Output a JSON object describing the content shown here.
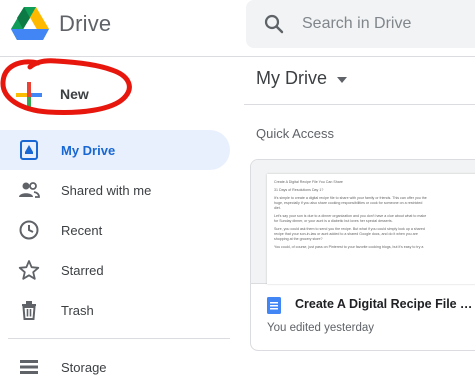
{
  "app": {
    "name": "Drive"
  },
  "search": {
    "placeholder": "Search in Drive",
    "value": "",
    "icon": "search-icon"
  },
  "new_button": {
    "label": "New"
  },
  "sidebar": {
    "items": [
      {
        "label": "My Drive",
        "icon": "my-drive-icon",
        "active": true
      },
      {
        "label": "Shared with me",
        "icon": "people-icon",
        "active": false
      },
      {
        "label": "Recent",
        "icon": "clock-icon",
        "active": false
      },
      {
        "label": "Starred",
        "icon": "star-icon",
        "active": false
      },
      {
        "label": "Trash",
        "icon": "trash-icon",
        "active": false
      }
    ],
    "storage": {
      "label": "Storage",
      "icon": "storage-icon"
    }
  },
  "main": {
    "title": "My Drive",
    "section": "Quick Access",
    "card": {
      "title": "Create A Digital Recipe File Y...",
      "subtitle": "You edited yesterday",
      "preview_lines": [
        "Create A Digital Recipe File You Can Share",
        "",
        "31 Days of Resolutions Day 1?",
        "",
        "It's simple to create a digital recipe file to share with your family or friends. This can offer you the",
        "huge, especially if you also share cooking responsibilities or cook for someone on a restricted",
        "diet.",
        "",
        "Let's say your son is due to a dinner organization and you don't have a clue about what to make",
        "for Sunday dinner, or your aunt is a diabetic but loves her special desserts.",
        "",
        "Sure, you could ask them to send you the recipe. But what if you could simply look up a shared",
        "recipe that your son-in-law or aunt added to a shared Google docs, and do it when you are",
        "shopping at the grocery store?",
        "",
        "You could, of course, just pass on Pinterest to your favorite cooking blogs, but it's easy to try a"
      ]
    }
  },
  "colors": {
    "accent": "#1967d2",
    "active_bg": "#e8f0fe",
    "search_bg": "#f1f3f4",
    "annotation": "#e8170e",
    "doc_blue": "#4285f4"
  }
}
